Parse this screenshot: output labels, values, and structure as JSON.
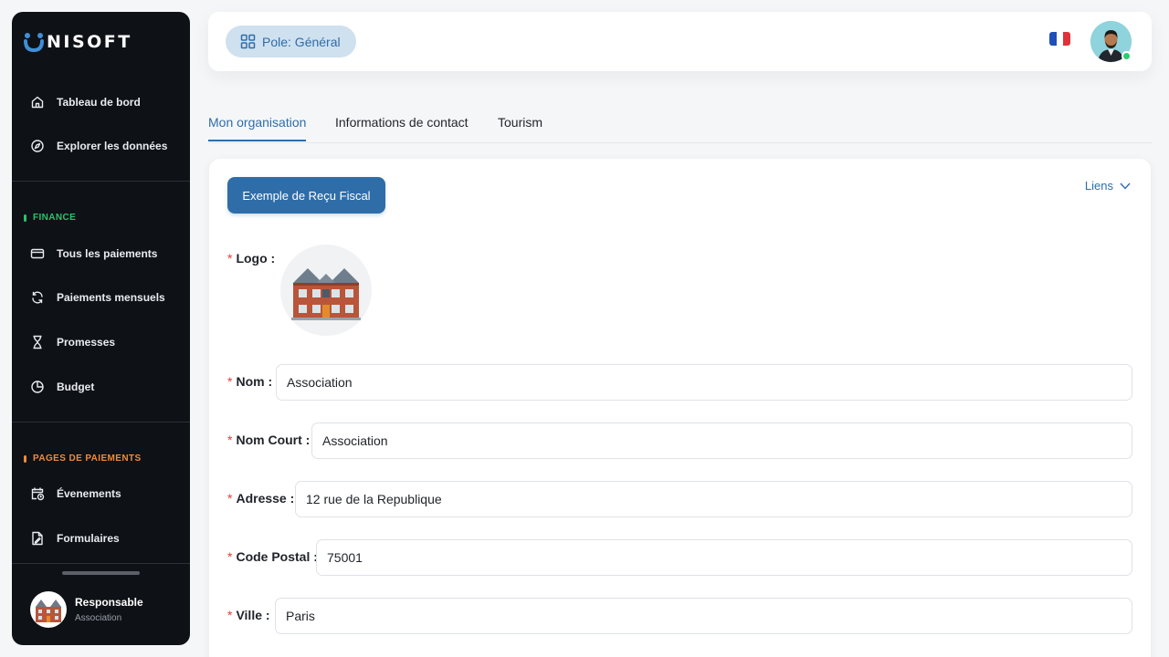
{
  "brand": {
    "name": "NISOFT",
    "accent": "#2f6da8"
  },
  "sidebar": {
    "items": [
      {
        "label": "Tableau de bord",
        "icon": "home-icon"
      },
      {
        "label": "Explorer les données",
        "icon": "compass-icon"
      }
    ],
    "finance": {
      "title": "FINANCE",
      "color": "#27c46b",
      "items": [
        {
          "label": "Tous les paiements",
          "icon": "credit-card-icon"
        },
        {
          "label": "Paiements mensuels",
          "icon": "refresh-icon"
        },
        {
          "label": "Promesses",
          "icon": "hourglass-icon"
        },
        {
          "label": "Budget",
          "icon": "pie-chart-icon"
        }
      ]
    },
    "pages": {
      "title": "PAGES DE PAIEMENTS",
      "color": "#f08a3c",
      "items": [
        {
          "label": "Évenements",
          "icon": "calendar-clock-icon"
        },
        {
          "label": "Formulaires",
          "icon": "form-document-icon"
        }
      ]
    },
    "user": {
      "name": "Responsable",
      "role": "Association"
    }
  },
  "header": {
    "pole": "Pole: Général",
    "language_icon": "french-flag-icon"
  },
  "tabs": [
    {
      "label": "Mon organisation",
      "active": true
    },
    {
      "label": "Informations de contact",
      "active": false
    },
    {
      "label": "Tourism",
      "active": false
    }
  ],
  "card": {
    "receipt_button": "Exemple de Reçu Fiscal",
    "links": "Liens",
    "logo_label": "Logo :",
    "required_mark": "*",
    "fields": [
      {
        "label": "Nom :",
        "value": "Association"
      },
      {
        "label": "Nom Court :",
        "value": "Association"
      },
      {
        "label": "Adresse :",
        "value": "12 rue de la Republique"
      },
      {
        "label": "Code Postal :",
        "value": "75001"
      },
      {
        "label": "Ville :",
        "value": "Paris"
      }
    ]
  }
}
